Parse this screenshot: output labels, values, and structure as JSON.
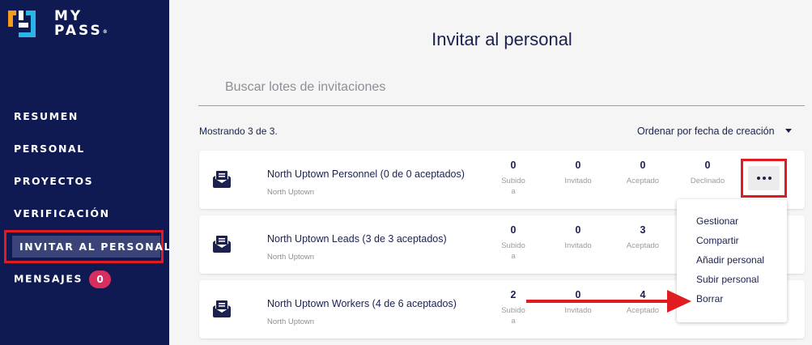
{
  "app": {
    "logo_line1": "MY",
    "logo_line2": "PASS",
    "logo_mark": "®"
  },
  "sidebar": {
    "items": [
      {
        "label": "RESUMEN"
      },
      {
        "label": "PERSONAL"
      },
      {
        "label": "PROYECTOS"
      },
      {
        "label": "VERIFICACIÓN"
      },
      {
        "label": "INVITAR AL PERSONAL",
        "active": true
      },
      {
        "label": "MENSAJES",
        "badge": "0"
      }
    ]
  },
  "main": {
    "title": "Invitar al personal",
    "search_placeholder": "Buscar lotes de invitaciones",
    "showing": "Mostrando 3 de 3.",
    "sort_label": "Ordenar por fecha de creación",
    "stat_labels": {
      "uploaded_1": "Subido",
      "uploaded_2": "a",
      "invited": "Invitado",
      "accepted": "Aceptado",
      "declined": "Declinado"
    },
    "cards": [
      {
        "title": "North Uptown Personnel (0 de 0 aceptados)",
        "subtitle": "North Uptown",
        "uploaded": "0",
        "invited": "0",
        "accepted": "0",
        "declined": "0"
      },
      {
        "title": "North Uptown Leads (3 de 3 aceptados)",
        "subtitle": "North Uptown",
        "uploaded": "0",
        "invited": "0",
        "accepted": "3"
      },
      {
        "title": "North Uptown Workers (4 de 6 aceptados)",
        "subtitle": "North Uptown",
        "uploaded": "2",
        "invited": "0",
        "accepted": "4"
      }
    ]
  },
  "dropdown": {
    "items": [
      {
        "label": "Gestionar"
      },
      {
        "label": "Compartir"
      },
      {
        "label": "Añadir personal"
      },
      {
        "label": "Subir personal"
      },
      {
        "label": "Borrar"
      }
    ]
  },
  "colors": {
    "sidebar_bg": "#0f1a52",
    "highlight": "#e01b22",
    "badge": "#d62f5f",
    "text": "#1b2150",
    "logo_orange": "#f39a1f",
    "logo_cyan": "#2bb4e6"
  },
  "icons": {
    "logo": "mypass-logo-mark",
    "card": "envelope-icon",
    "more": "more-horizontal-icon",
    "sort": "caret-down-icon",
    "annotation": "red-arrow"
  }
}
